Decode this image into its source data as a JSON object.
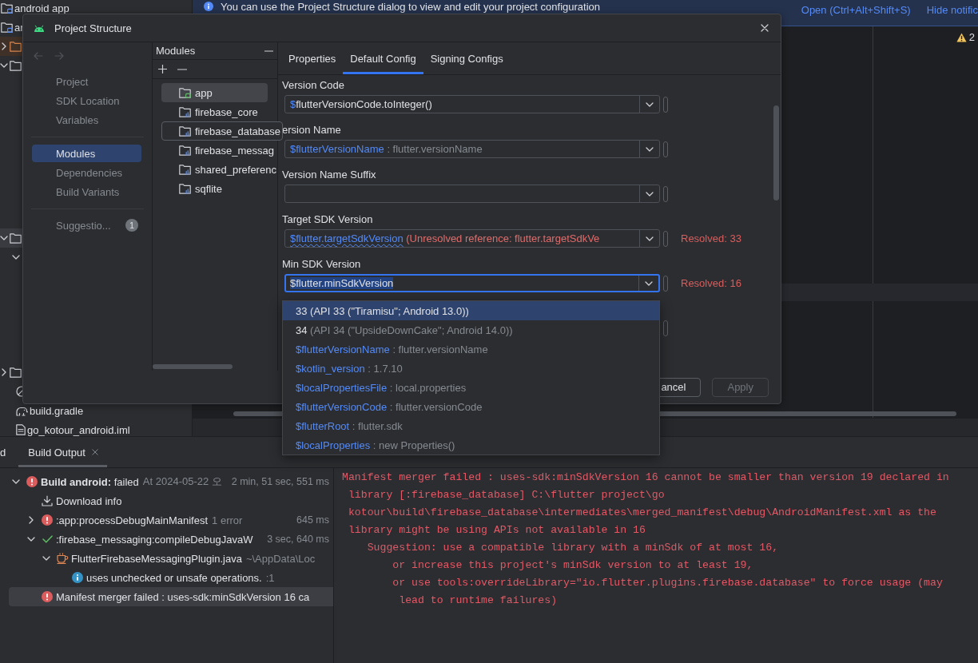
{
  "ide_banner": {
    "message": "You can use the Project Structure dialog to view and edit your project configuration",
    "links": [
      "Open (Ctrl+Alt+Shift+S)",
      "Hide notific"
    ]
  },
  "project_tree": {
    "items": [
      {
        "kind": "module",
        "label": "android app",
        "selected": false
      },
      {
        "kind": "module",
        "label": "ar",
        "selected": false
      },
      {
        "kind": "excluded_folder",
        "expanded": false,
        "selected": false
      },
      {
        "kind": "folder",
        "expanded": true,
        "selected": false
      },
      {
        "kind": "folder",
        "expanded": true,
        "selected": true,
        "children": [
          {
            "expanded": true,
            "selected": false
          }
        ]
      },
      {
        "kind": "folder",
        "expanded": false,
        "selected": false
      },
      {
        "kind": "ignored",
        "selected": false
      },
      {
        "kind": "gradle",
        "label": "build.gradle",
        "selected": false
      },
      {
        "kind": "file",
        "label": "go_kotour_android.iml",
        "selected": false
      }
    ]
  },
  "editor": {
    "warning_count": "2"
  },
  "dialog": {
    "title": "Project Structure",
    "nav_arrows": [
      {
        "kind": "back",
        "disabled": true
      },
      {
        "kind": "forward",
        "disabled": true
      }
    ],
    "nav_sections": [
      {
        "items": [
          {
            "label": "Project",
            "selected": false
          },
          {
            "label": "SDK Location",
            "selected": false
          },
          {
            "label": "Variables",
            "selected": false
          }
        ]
      },
      {
        "items": [
          {
            "label": "Modules",
            "selected": true
          },
          {
            "label": "Dependencies",
            "selected": false
          },
          {
            "label": "Build Variants",
            "selected": false
          }
        ]
      },
      {
        "items": [
          {
            "label": "Suggestio...",
            "selected": false,
            "badge": "1"
          }
        ]
      }
    ],
    "modules": {
      "title": "Modules",
      "items": [
        {
          "label": "app",
          "kind": "app",
          "selected": true,
          "hovered": false
        },
        {
          "label": "firebase_core",
          "kind": "library",
          "selected": false,
          "hovered": false
        },
        {
          "label": "firebase_database",
          "kind": "library",
          "selected": false,
          "hovered": true
        },
        {
          "label": "firebase_messag",
          "kind": "library",
          "selected": false,
          "hovered": false
        },
        {
          "label": "shared_preferenc",
          "kind": "library",
          "selected": false,
          "hovered": false
        },
        {
          "label": "sqflite",
          "kind": "library",
          "selected": false,
          "hovered": false
        }
      ]
    },
    "tabs": [
      {
        "label": "Properties",
        "selected": false
      },
      {
        "label": "Default Config",
        "selected": true
      },
      {
        "label": "Signing Configs",
        "selected": false
      }
    ],
    "fields": [
      {
        "kind": "combo",
        "label": "Version Code",
        "focused": false,
        "value": [
          {
            "text": "$",
            "kind": "reference"
          },
          {
            "text": "flutterVersionCode.toInteger()",
            "kind": "plain"
          }
        ]
      },
      {
        "kind": "combo",
        "label": "ersion Name",
        "focused": false,
        "value": [
          {
            "text": "$flutterVersionName",
            "kind": "reference"
          },
          {
            "text": " : flutter.versionName",
            "kind": "hint"
          }
        ]
      },
      {
        "kind": "combo",
        "label": "Version Name Suffix",
        "focused": false
      },
      {
        "kind": "combo",
        "label": "Target SDK Version",
        "focused": false,
        "value": [
          {
            "text": "$flutter.targetSdkVersion",
            "kind": "unresolved"
          },
          {
            "text": " (Unresolved reference: flutter.targetSdkVe",
            "kind": "error"
          }
        ],
        "resolved": "Resolved: 33"
      },
      {
        "kind": "combo",
        "label": "Min SDK Version",
        "focused": true,
        "text_selected": true,
        "value": [
          {
            "text": "$flutter.minSdkVersion",
            "kind": "plain"
          }
        ],
        "resolved": "Resolved: 16"
      },
      {
        "kind": "handle_only"
      }
    ],
    "buttons": [
      {
        "label": "ancel",
        "disabled": false
      },
      {
        "label": "Apply",
        "disabled": true
      }
    ]
  },
  "completion_popup": {
    "items": [
      {
        "name": "33",
        "detail": " (API 33 (\"Tiramisu\"; Android 13.0))",
        "kind": "sdk",
        "selected": true
      },
      {
        "name": "34",
        "detail": " (API 34 (\"UpsideDownCake\"; Android 14.0))",
        "kind": "sdk",
        "selected": false
      },
      {
        "name": "$flutterVersionName",
        "detail": " : flutter.versionName",
        "kind": "variable",
        "selected": false
      },
      {
        "name": "$kotlin_version",
        "detail": " : 1.7.10",
        "kind": "variable",
        "selected": false
      },
      {
        "name": "$localPropertiesFile",
        "detail": " : local.properties",
        "kind": "variable",
        "selected": false
      },
      {
        "name": "$flutterVersionCode",
        "detail": " : flutter.versionCode",
        "kind": "variable",
        "selected": false
      },
      {
        "name": "$flutterRoot",
        "detail": " : flutter.sdk",
        "kind": "variable",
        "selected": false
      },
      {
        "name": "$localProperties",
        "detail": " : new Properties()",
        "kind": "variable",
        "selected": false
      }
    ]
  },
  "bottom_panel": {
    "tabs": [
      {
        "label": "d",
        "selected": false,
        "closable": false
      },
      {
        "label": "Build Output",
        "selected": true,
        "closable": true
      }
    ],
    "build_tree": [
      {
        "label": "**Build android:** failed",
        "detail": "At 2024-05-22 오",
        "duration": "2 min, 51 sec, 551 ms",
        "kind": "error",
        "expanded": true,
        "selected": false,
        "children": [
          {
            "label": "Download info",
            "kind": "download",
            "selected": false
          },
          {
            "label": ":app:processDebugMainManifest",
            "detail": "1 error",
            "duration": "645 ms",
            "kind": "error",
            "expanded": false,
            "selected": false
          },
          {
            "label": ":firebase_messaging:compileDebugJavaW",
            "duration": "3 sec, 640 ms",
            "kind": "success",
            "expanded": true,
            "selected": false,
            "children": [
              {
                "label": "FlutterFirebaseMessagingPlugin.java",
                "detail": "~\\AppData\\Loc",
                "kind": "java",
                "expanded": true,
                "selected": false,
                "children": [
                  {
                    "label": "uses unchecked or unsafe operations.",
                    "detail": ":1",
                    "kind": "info",
                    "selected": false
                  }
                ]
              }
            ]
          },
          {
            "label": "Manifest merger failed : uses-sdk:minSdkVersion 16 ca",
            "kind": "error",
            "selected": true
          }
        ]
      }
    ],
    "console": {
      "lines": [
        "Manifest merger failed : uses-sdk:minSdkVersion 16 cannot be smaller than version 19 declared in",
        " library [:firebase_database] C:\\flutter project\\go",
        " kotour\\build\\firebase_database\\intermediates\\merged_manifest\\debug\\AndroidManifest.xml as the",
        " library might be using APIs not available in 16",
        "    Suggestion: use a compatible library with a minSdk of at most 16,",
        "        or increase this project's minSdk version to at least 19,",
        "        or use tools:overrideLibrary=\"io.flutter.plugins.firebase.database\" to force usage (may",
        "         lead to runtime failures)"
      ]
    }
  }
}
